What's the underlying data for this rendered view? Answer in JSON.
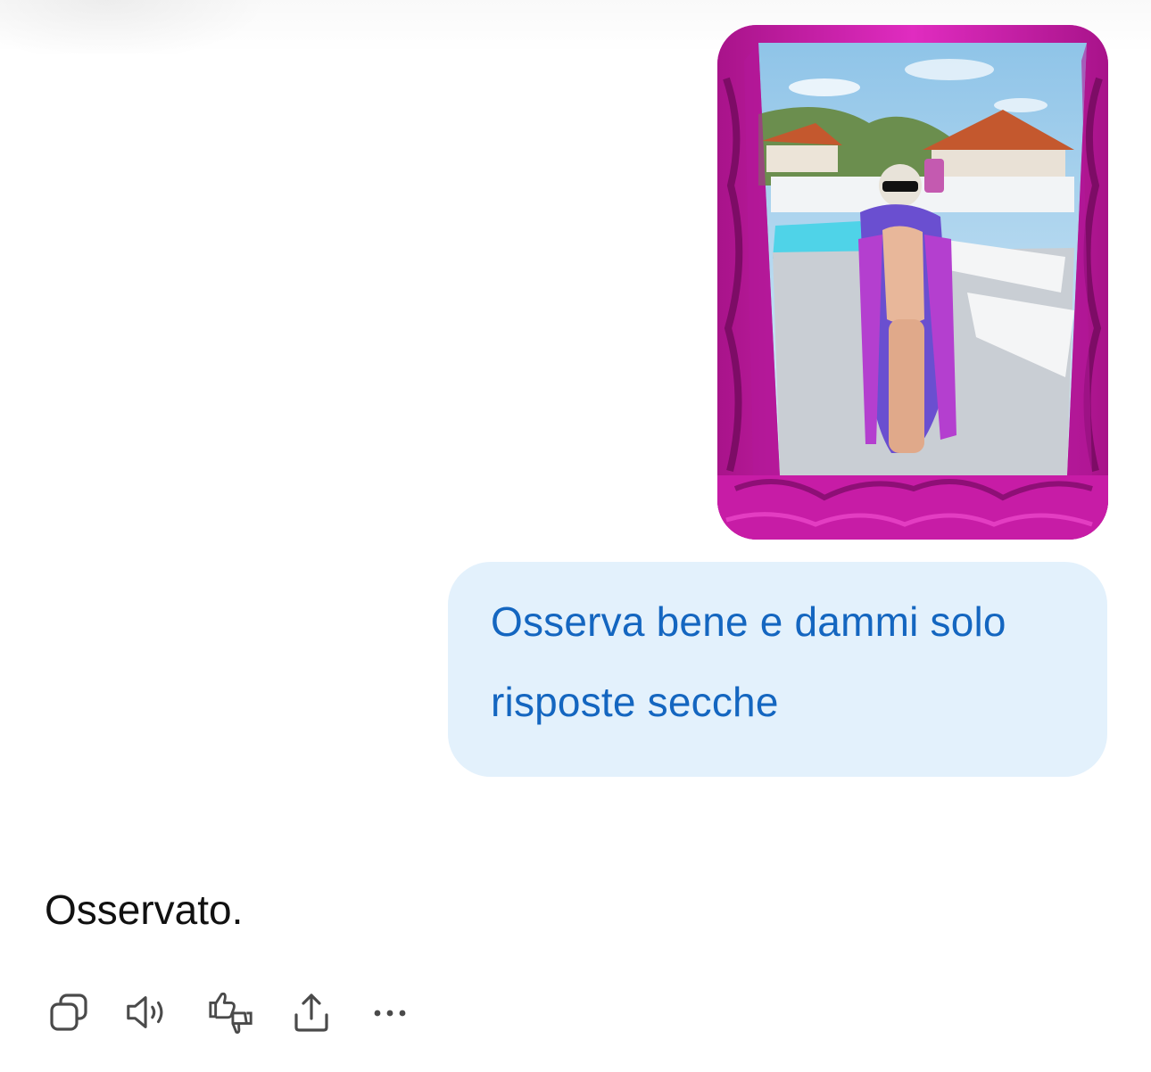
{
  "conversation": {
    "user_image": {
      "alt": "",
      "icon": "photo-attachment"
    },
    "user_message": "Osserva bene e dammi solo risposte secche",
    "assistant_message": "Osservato."
  },
  "actions": [
    {
      "name": "copy",
      "icon": "copy-icon"
    },
    {
      "name": "read-aloud",
      "icon": "speaker-icon"
    },
    {
      "name": "feedback",
      "icon": "thumbs-icon"
    },
    {
      "name": "share",
      "icon": "share-icon"
    },
    {
      "name": "more",
      "icon": "more-icon"
    }
  ],
  "colors": {
    "user_bubble_bg": "#e3f1fc",
    "user_text": "#1466c0",
    "assistant_text": "#111111",
    "icon_stroke": "#4a4a4a",
    "frame_magenta": "#d21fb0"
  }
}
